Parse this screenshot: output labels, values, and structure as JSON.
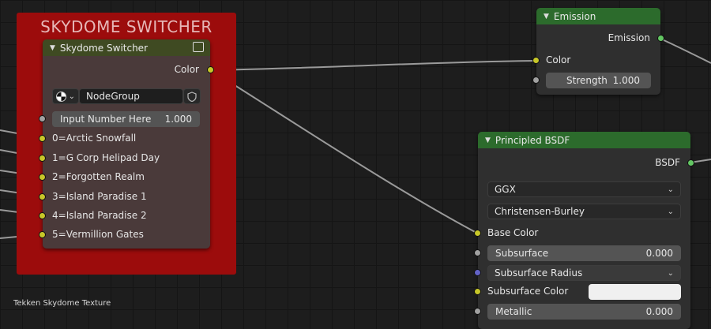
{
  "frame": {
    "title": "SKYDOME SWITCHER",
    "color": "#9c0c0c"
  },
  "group_node": {
    "header": "Skydome Switcher",
    "header_color": "#3f4a22",
    "output_label": "Color",
    "group_type_icon": "sphere-icon",
    "node_group_name": "NodeGroup",
    "fake_user_icon": "shield-icon",
    "input_field": {
      "label": "Input Number Here",
      "value": "1.000"
    },
    "inputs": [
      "0=Arctic Snowfall",
      "1=G Corp Helipad Day",
      "2=Forgotten Realm",
      "3=Island Paradise 1",
      "4=Island Paradise 2",
      "5=Vermillion Gates"
    ]
  },
  "emission_node": {
    "header": "Emission",
    "header_color": "#2c6b2c",
    "output_label": "Emission",
    "color_label": "Color",
    "strength": {
      "label": "Strength",
      "value": "1.000"
    }
  },
  "bsdf_node": {
    "header": "Principled BSDF",
    "header_color": "#2c6b2c",
    "output_label": "BSDF",
    "distribution": "GGX",
    "subsurface_method": "Christensen-Burley",
    "base_color_label": "Base Color",
    "subsurface": {
      "label": "Subsurface",
      "value": "0.000"
    },
    "subsurface_radius_label": "Subsurface Radius",
    "subsurface_color_label": "Subsurface Color",
    "subsurface_color_value": "#f0f0f0",
    "metallic": {
      "label": "Metallic",
      "value": "0.000"
    }
  },
  "caption": "Tekken Skydome Texture"
}
